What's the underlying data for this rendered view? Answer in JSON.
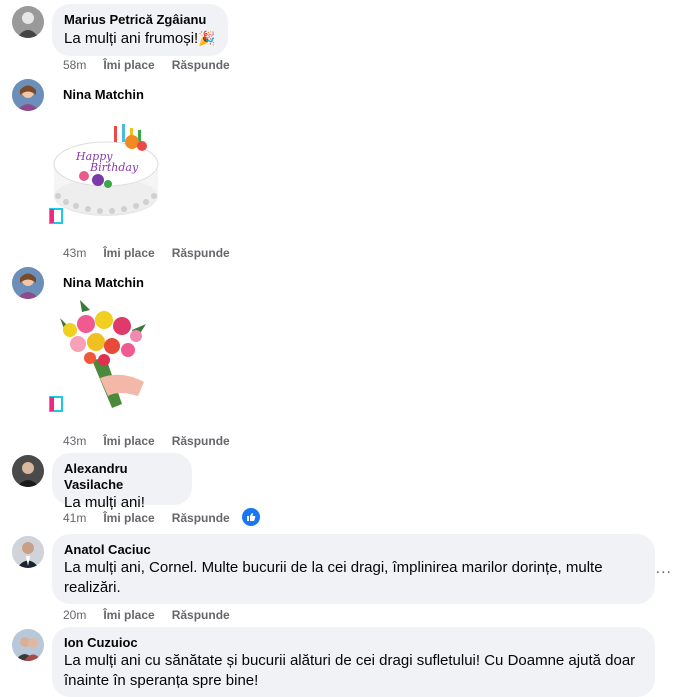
{
  "colors": {
    "bubble_bg": "#f0f2f5",
    "meta_text": "#65676b",
    "like_blue": "#1877f2"
  },
  "comments": [
    {
      "author": "Marius Petrică Zgâianu",
      "text": "La mulți ani frumoși!",
      "emoji": "party-popper-icon",
      "time": "58m",
      "like_label": "Îmi place",
      "reply_label": "Răspunde"
    },
    {
      "author": "Nina Matchin",
      "sticker": "birthday-cake-sticker",
      "time": "43m",
      "like_label": "Îmi place",
      "reply_label": "Răspunde"
    },
    {
      "author": "Nina Matchin",
      "sticker": "flower-bouquet-sticker",
      "time": "43m",
      "like_label": "Îmi place",
      "reply_label": "Răspunde"
    },
    {
      "author": "Alexandru Vasilache",
      "text": "La mulți ani!",
      "time": "41m",
      "like_label": "Îmi place",
      "reply_label": "Răspunde",
      "reaction": "like-reaction-icon"
    },
    {
      "author": "Anatol Caciuc",
      "text": "La mulți ani, Cornel. Multe bucurii de la cei dragi, împlinirea marilor dorințe, multe realizări.",
      "time": "20m",
      "like_label": "Îmi place",
      "reply_label": "Răspunde",
      "more": "..."
    },
    {
      "author": "Ion Cuzuioc",
      "text": "La mulți ani cu sănătate și bucurii alături de cei dragi sufletului! Cu Doamne ajută doar înainte în speranța spre bine!"
    }
  ]
}
